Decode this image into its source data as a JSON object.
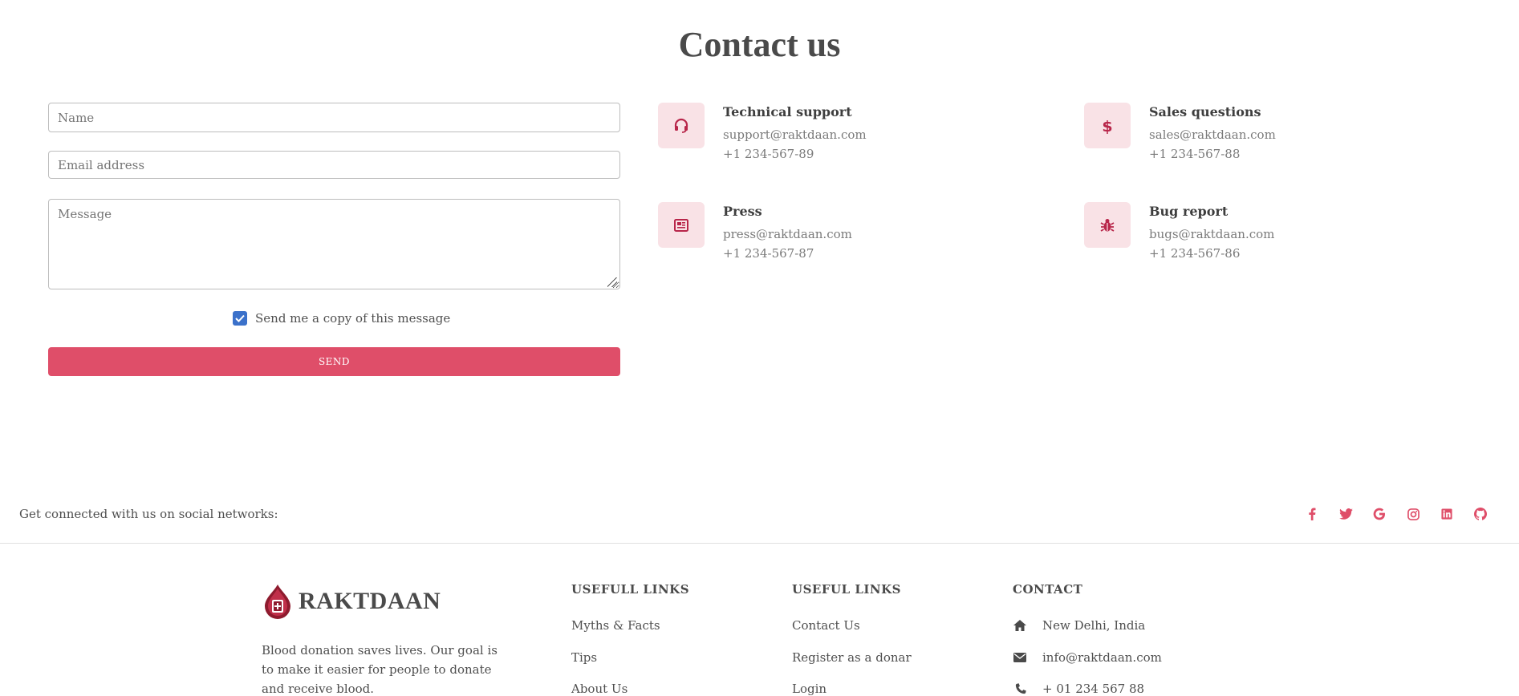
{
  "page": {
    "title": "Contact us"
  },
  "form": {
    "name_placeholder": "Name",
    "email_placeholder": "Email address",
    "message_placeholder": "Message",
    "copy_checkbox_label": "Send me a copy of this message",
    "copy_checkbox_checked": true,
    "send_label": "SEND"
  },
  "contacts": [
    {
      "icon": "headset-icon",
      "title": "Technical support",
      "email": "support@raktdaan.com",
      "phone": "+1 234-567-89"
    },
    {
      "icon": "dollar-icon",
      "title": "Sales questions",
      "email": "sales@raktdaan.com",
      "phone": "+1 234-567-88"
    },
    {
      "icon": "newspaper-icon",
      "title": "Press",
      "email": "press@raktdaan.com",
      "phone": "+1 234-567-87"
    },
    {
      "icon": "bug-icon",
      "title": "Bug report",
      "email": "bugs@raktdaan.com",
      "phone": "+1 234-567-86"
    }
  ],
  "social": {
    "text": "Get connected with us on social networks:",
    "icons": [
      "facebook-icon",
      "twitter-icon",
      "google-icon",
      "instagram-icon",
      "linkedin-icon",
      "github-icon"
    ]
  },
  "footer": {
    "brand": "RAKTDAAN",
    "description": "Blood donation saves lives. Our goal is to make it easier for people to donate and receive blood.",
    "col1": {
      "heading": "USEFULL LINKS",
      "links": [
        "Myths & Facts",
        "Tips",
        "About Us"
      ]
    },
    "col2": {
      "heading": "USEFUL LINKS",
      "links": [
        "Contact Us",
        "Register as a donar",
        "Login"
      ]
    },
    "contact": {
      "heading": "CONTACT",
      "address": "New Delhi, India",
      "email": "info@raktdaan.com",
      "phone": "+ 01 234 567 88"
    }
  },
  "colors": {
    "accent": "#df4e69",
    "icon_bg": "#f9e2e6",
    "icon_fg": "#b8264a",
    "checkbox": "#3b71ca"
  }
}
